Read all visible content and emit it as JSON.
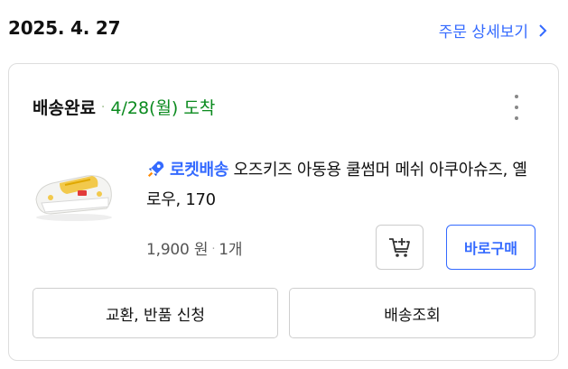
{
  "header": {
    "order_date": "2025. 4. 27",
    "detail_link_label": "주문 상세보기"
  },
  "delivery": {
    "status": "배송완료",
    "separator": "·",
    "arrival": "4/28(월) 도착"
  },
  "product": {
    "badge": "로켓배송",
    "name": "오즈키즈 아동용 쿨썸머 메쉬 아쿠아슈즈, 옐로우, 170",
    "price": "1,900 원",
    "qty": "1개",
    "image": "yellow-mesh-aqua-shoes"
  },
  "buttons": {
    "buy_now": "바로구매",
    "exchange_return": "교환, 반품 신청",
    "tracking": "배송조회"
  },
  "colors": {
    "accent_blue": "#346aff",
    "arrival_green": "#0a8a1e"
  }
}
